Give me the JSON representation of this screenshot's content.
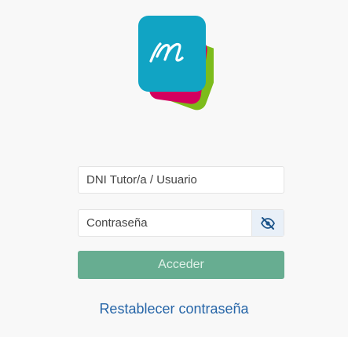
{
  "login": {
    "user_placeholder": "DNI Tutor/a / Usuario",
    "user_value": "",
    "password_placeholder": "Contraseña",
    "password_value": "",
    "password_toggle_icon": "eye-slash-icon",
    "submit_label": "Acceder",
    "reset_link": "Restablecer contraseña"
  },
  "logo": {
    "icon": "app-logo-icon",
    "letter": "m",
    "colors": {
      "front": "#11a4c4",
      "middle": "#d3005e",
      "back": "#7cbc1b",
      "letter": "#ffffff"
    }
  },
  "colors": {
    "background": "#f8f8f8",
    "primary_button": "#67ad91",
    "link": "#2766a8",
    "toggle_bg": "#e9f0f8",
    "toggle_icon": "#1b5389"
  }
}
